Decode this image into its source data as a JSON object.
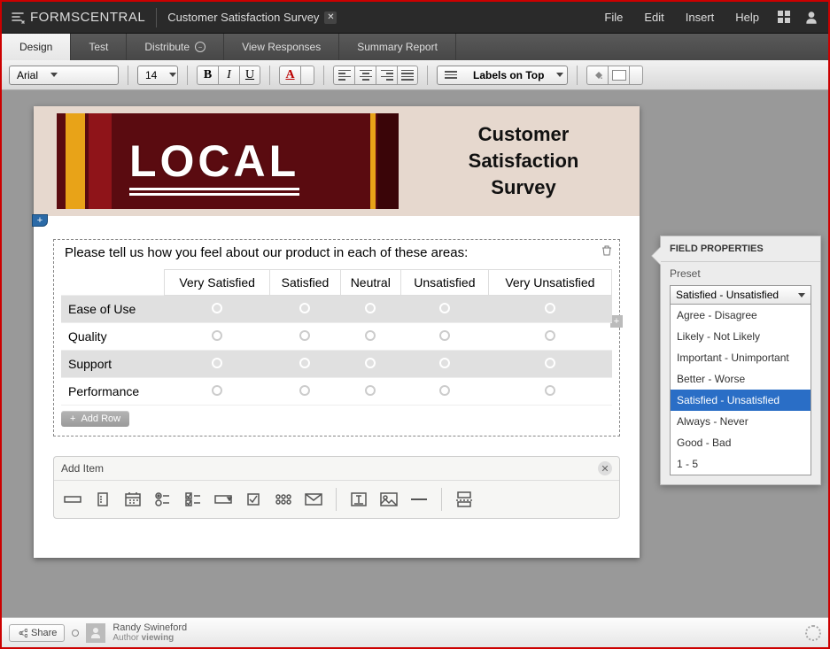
{
  "app": {
    "name": "FORMSCENTRAL",
    "doc_title": "Customer Satisfaction Survey"
  },
  "menu": {
    "file": "File",
    "edit": "Edit",
    "insert": "Insert",
    "help": "Help"
  },
  "tabs": {
    "design": "Design",
    "test": "Test",
    "distribute": "Distribute",
    "view_responses": "View Responses",
    "summary_report": "Summary Report"
  },
  "format": {
    "font": "Arial",
    "size": "14",
    "labels_on_top": "Labels on Top"
  },
  "banner": {
    "logo_text": "LOCAL",
    "title_l1": "Customer",
    "title_l2": "Satisfaction",
    "title_l3": "Survey"
  },
  "question": {
    "text": "Please tell us how you feel about our product in each of these areas:",
    "cols": [
      "Very Satisfied",
      "Satisfied",
      "Neutral",
      "Unsatisfied",
      "Very Unsatisfied"
    ],
    "rows": [
      "Ease of Use",
      "Quality",
      "Support",
      "Performance"
    ],
    "add_row": "Add Row"
  },
  "add_item": {
    "title": "Add Item"
  },
  "field_props": {
    "title": "FIELD PROPERTIES",
    "preset_label": "Preset",
    "selected": "Satisfied - Unsatisfied",
    "options": [
      "Agree - Disagree",
      "Likely - Not Likely",
      "Important - Unimportant",
      "Better - Worse",
      "Satisfied - Unsatisfied",
      "Always - Never",
      "Good - Bad",
      "1 - 5"
    ]
  },
  "status": {
    "share": "Share",
    "author_name": "Randy Swineford",
    "author_role": "Author",
    "author_state": "viewing"
  }
}
